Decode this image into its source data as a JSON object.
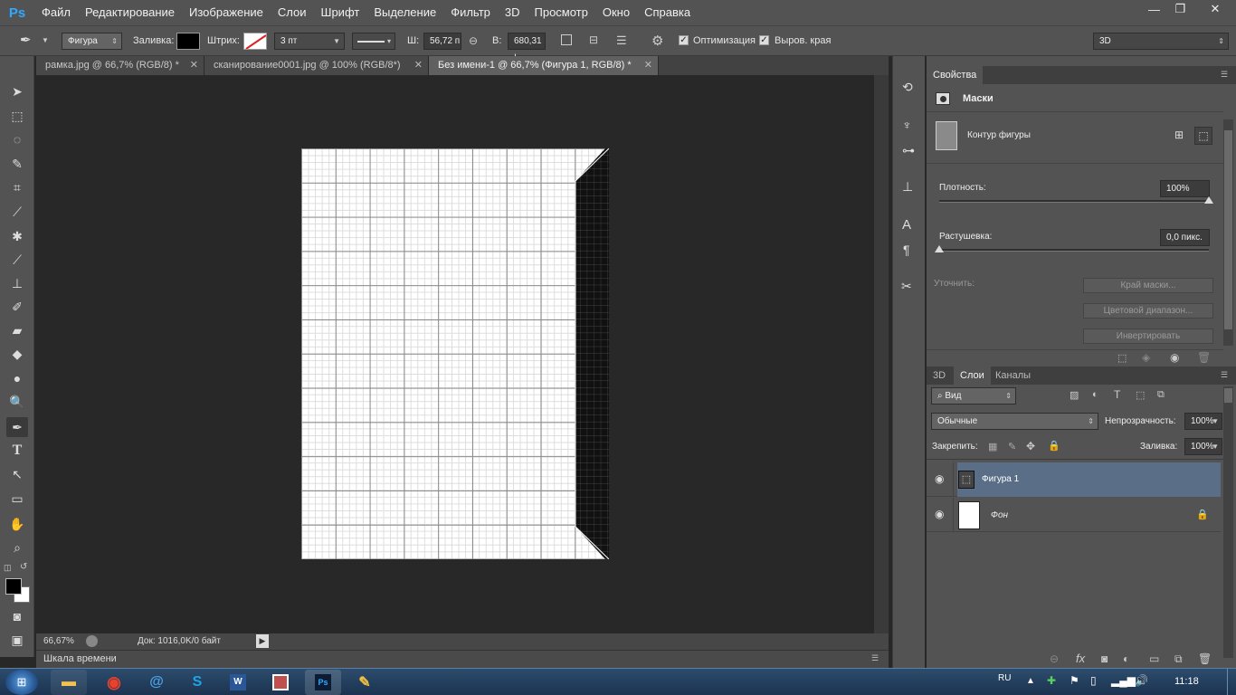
{
  "app": {
    "logo": "Ps"
  },
  "menu": [
    "Файл",
    "Редактирование",
    "Изображение",
    "Слои",
    "Шрифт",
    "Выделение",
    "Фильтр",
    "3D",
    "Просмотр",
    "Окно",
    "Справка"
  ],
  "options": {
    "shape_mode": "Фигура",
    "fill_label": "Заливка:",
    "fill_color": "#000000",
    "stroke_label": "Штрих:",
    "stroke_width": "3 пт",
    "w_label": "Ш:",
    "w_value": "56,72 п",
    "h_label": "В:",
    "h_value": "680,31 ı",
    "antialias_label": "Оптимизация",
    "align_edges_label": "Выров. края",
    "workspace": "3D"
  },
  "tabs": [
    {
      "label": "рамка.jpg @ 66,7% (RGB/8) *",
      "active": false
    },
    {
      "label": "сканирование0001.jpg @ 100% (RGB/8*)",
      "active": false
    },
    {
      "label": "Без имени-1 @ 66,7% (Фигура 1, RGB/8) *",
      "active": true
    }
  ],
  "status": {
    "zoom": "66,67%",
    "doc": "Док: 1016,0K/0 байт"
  },
  "timeline": {
    "label": "Шкала времени"
  },
  "properties": {
    "tab": "Свойства",
    "section": "Маски",
    "mask_label": "Контур фигуры",
    "density_label": "Плотность:",
    "density_value": "100%",
    "density": 1.0,
    "feather_label": "Растушевка:",
    "feather_value": "0,0 пикс.",
    "feather": 0.0,
    "refine_label": "Уточнить:",
    "btn_mask_edge": "Край маски...",
    "btn_color_range": "Цветовой диапазон...",
    "btn_invert": "Инвертировать"
  },
  "layers_panel": {
    "tabs": [
      "3D",
      "Слои",
      "Каналы"
    ],
    "active_tab": "Слои",
    "filter": "Вид",
    "blend_mode": "Обычные",
    "opacity_label": "Непрозрачность:",
    "opacity_value": "100%",
    "lock_label": "Закрепить:",
    "fill_label": "Заливка:",
    "fill_value": "100%",
    "layers": [
      {
        "name": "Фигура 1",
        "selected": true
      },
      {
        "name": "Фон",
        "selected": false,
        "locked": true
      }
    ]
  },
  "taskbar": {
    "lang": "RU",
    "time": "11:18",
    "apps": [
      "explorer",
      "chrome",
      "mail",
      "skype",
      "word",
      "presentation",
      "photoshop",
      "paint"
    ],
    "app_labels": {
      "word": "W",
      "photoshop": "Ps"
    }
  },
  "colors": {
    "accent_blue": "#31a8ff",
    "selected_layer": "#5a6e87",
    "taskbar": "#1f3a5a"
  }
}
